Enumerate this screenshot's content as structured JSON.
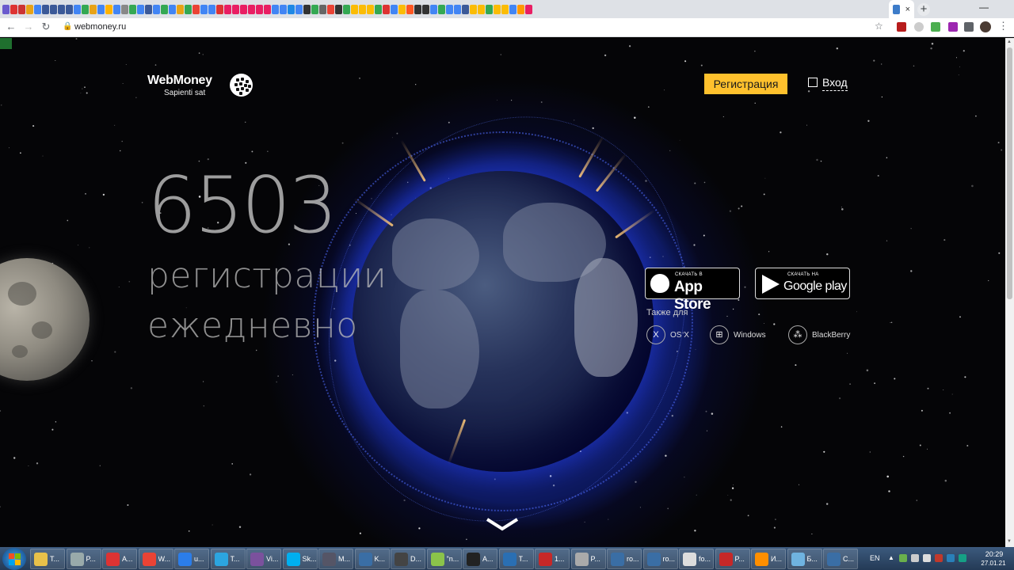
{
  "browser": {
    "tab_favicon_colors": [
      "#6a5acd",
      "#d33",
      "#c33",
      "#e8a317",
      "#4285f4",
      "#3b5998",
      "#3b5998",
      "#3b5998",
      "#3b5998",
      "#4285f4",
      "#34a853",
      "#e8a317",
      "#4285f4",
      "#ffb300",
      "#4285f4",
      "#888",
      "#34a853",
      "#4285f4",
      "#3b5998",
      "#4285f4",
      "#34a853",
      "#4285f4",
      "#e8a317",
      "#34a853",
      "#ea4335",
      "#4285f4",
      "#4285f4",
      "#d33",
      "#e91e63",
      "#e91e63",
      "#e91e63",
      "#e91e63",
      "#e91e63",
      "#e91e63",
      "#4285f4",
      "#4285f4",
      "#1e88e5",
      "#4285f4",
      "#333",
      "#34a853",
      "#666",
      "#ea4335",
      "#333",
      "#34a853",
      "#fbbc05",
      "#fbbc05",
      "#fbbc05",
      "#34a853",
      "#d33",
      "#4285f4",
      "#fbbc05",
      "#ff5722",
      "#333",
      "#333",
      "#4285f4",
      "#34a853",
      "#4285f4",
      "#4285f4",
      "#3b5998",
      "#fbbc05",
      "#fbbc05",
      "#34a853",
      "#fbbc05",
      "#fbbc05",
      "#4285f4",
      "#ff9800",
      "#e91e63"
    ],
    "active_tab_close": "×",
    "new_tab": "+",
    "minimize": "—",
    "url": "webmoney.ru",
    "nav_back": "←",
    "nav_forward": "→",
    "nav_reload": "↻",
    "lock": "🔒",
    "bookmark_star": "☆",
    "menu": "⋮"
  },
  "site": {
    "logo_name": "WebMoney",
    "logo_tagline": "Sapienti sat",
    "register_label": "Регистрация",
    "login_label": "Вход",
    "counter": "6503",
    "line1": "регистрации",
    "line2": "ежедневно",
    "appstore_small": "СКАЧАТЬ В",
    "appstore_big": "App Store",
    "googleplay_small": "СКАЧАТЬ НА",
    "googleplay_big": "Google play",
    "also_for": "Также для",
    "platforms": [
      {
        "icon": "osx-icon",
        "label": "OS X"
      },
      {
        "icon": "windows-icon",
        "label": "Windows"
      },
      {
        "icon": "blackberry-icon",
        "label": "BlackBerry"
      }
    ],
    "accent_color": "#ffc12d"
  },
  "taskbar": {
    "tasks": [
      {
        "label": "T...",
        "color": "#e8c14a"
      },
      {
        "label": "P...",
        "color": "#9aa"
      },
      {
        "label": "A...",
        "color": "#d33"
      },
      {
        "label": "W...",
        "color": "#ea4335"
      },
      {
        "label": "u...",
        "color": "#2b7de9"
      },
      {
        "label": "T...",
        "color": "#2ca5e0"
      },
      {
        "label": "Vi...",
        "color": "#7b519d"
      },
      {
        "label": "Sk...",
        "color": "#00aff0"
      },
      {
        "label": "M...",
        "color": "#556"
      },
      {
        "label": "K...",
        "color": "#3a6ea5"
      },
      {
        "label": "D...",
        "color": "#444"
      },
      {
        "label": "\"n...",
        "color": "#8bc34a"
      },
      {
        "label": "A...",
        "color": "#222"
      },
      {
        "label": "T...",
        "color": "#2a6fb3"
      },
      {
        "label": "1...",
        "color": "#c62828"
      },
      {
        "label": "P...",
        "color": "#aaa"
      },
      {
        "label": "ro...",
        "color": "#3a6ea5"
      },
      {
        "label": "ro...",
        "color": "#3a6ea5"
      },
      {
        "label": "fo...",
        "color": "#ddd"
      },
      {
        "label": "P...",
        "color": "#c62828"
      },
      {
        "label": "И...",
        "color": "#ff8f00"
      },
      {
        "label": "Б...",
        "color": "#6fb3e0"
      },
      {
        "label": "C...",
        "color": "#3a6ea5"
      }
    ],
    "lang": "EN",
    "time": "20:29",
    "date": "27.01.21"
  }
}
